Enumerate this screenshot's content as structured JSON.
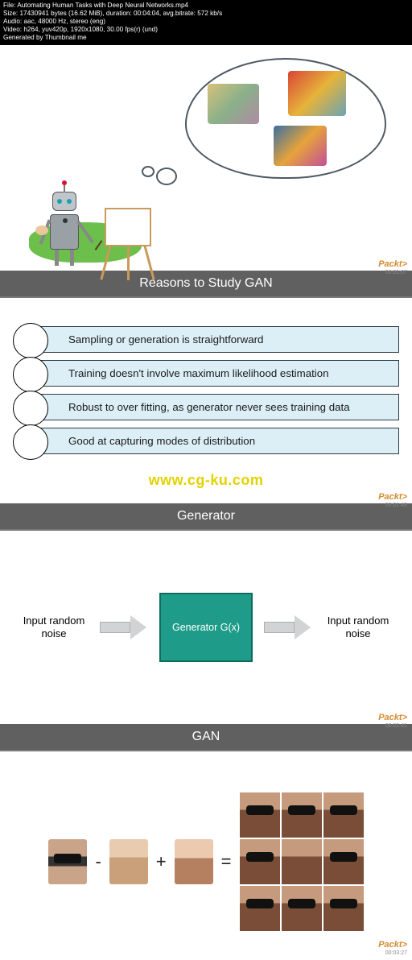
{
  "meta": {
    "file": "File: Automating Human Tasks with Deep Neural Networks.mp4",
    "size": "Size: 17430941 bytes (16.62 MiB), duration: 00:04:04, avg.bitrate: 572 kb/s",
    "audio": "Audio: aac, 48000 Hz, stereo (eng)",
    "video": "Video: h264, yuv420p, 1920x1080, 30.00 fps(r) (und)",
    "generated": "Generated by Thumbnail me"
  },
  "watermark": "www.cg-ku.com",
  "brand": "Packt>",
  "slides": {
    "s2": {
      "heading": "Reasons to Study GAN",
      "reasons": [
        "Sampling or generation is straightforward",
        "Training doesn't involve maximum likelihood estimation",
        "Robust to over fitting, as generator never sees training data",
        "Good at capturing modes of distribution"
      ],
      "timecode": "00:01:49"
    },
    "s3": {
      "heading": "Generator",
      "left_label": "Input random noise",
      "box_label": "Generator G(x)",
      "right_label": "Input random noise",
      "timecode": "00:02:41"
    },
    "s4": {
      "heading": "GAN",
      "op_minus": "-",
      "op_plus": "+",
      "op_eq": "=",
      "timecode": "00:03:27"
    },
    "s1": {
      "timecode": "00:01:07"
    }
  }
}
